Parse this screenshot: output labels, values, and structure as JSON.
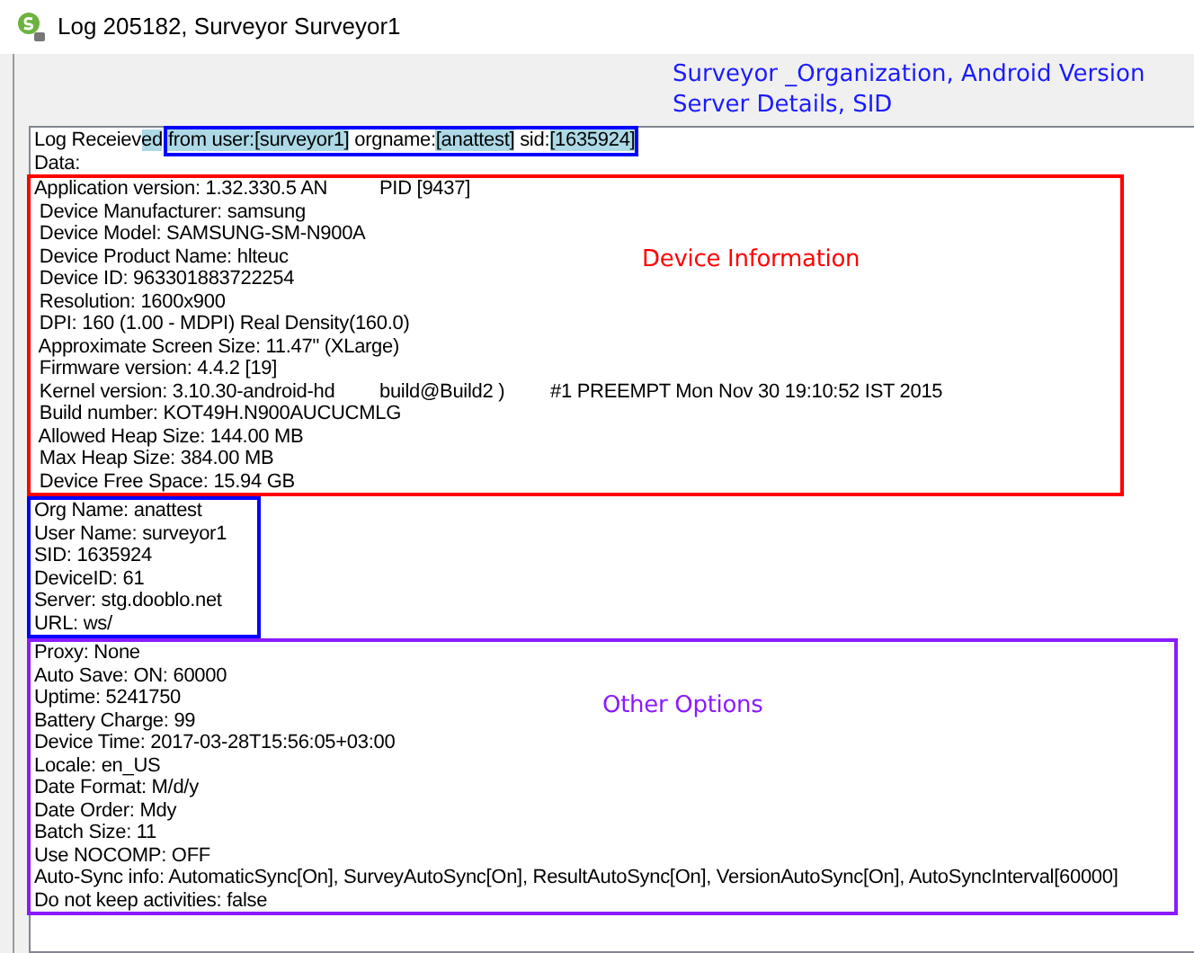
{
  "window": {
    "title": "Log 205182, Surveyor Surveyor1"
  },
  "callout": {
    "lines": [
      "Surveyor _Organization, Android Version",
      "Server Details, SID"
    ],
    "color": "#1a1aff"
  },
  "log": {
    "header": [
      {
        "segments": [
          {
            "text": "Log Receiev",
            "selected": false,
            "outlined": false
          },
          {
            "text": "ed",
            "selected": true,
            "outlined": false
          },
          {
            "text": "from user:[surveyor1]",
            "selected": true,
            "outlined": true
          },
          {
            "text": " orgname:",
            "selected": false,
            "outlined": true
          },
          {
            "text": "[anattest]",
            "selected": true,
            "outlined": true
          },
          {
            "text": " sid:",
            "selected": false,
            "outlined": true
          },
          {
            "text": "[1635924]",
            "selected": true,
            "outlined": true
          }
        ]
      },
      {
        "segments": [
          {
            "text": "Data:",
            "selected": false,
            "outlined": false
          }
        ]
      }
    ],
    "groups": [
      {
        "label": "Device Information",
        "color": "#ff0000",
        "lines": [
          [
            "Application version: 1.32.330.5 AN",
            "PID [9437]"
          ],
          [
            " Device Manufacturer: samsung"
          ],
          [
            " Device Model: SAMSUNG-SM-N900A"
          ],
          [
            " Device Product Name: hlteuc"
          ],
          [
            " Device ID: 963301883722254"
          ],
          [
            " Resolution: 1600x900"
          ],
          [
            " DPI: 160 (1.00 - MDPI) Real Density(160.0)"
          ],
          [
            " Approximate Screen Size: 11.47\" (XLarge)"
          ],
          [
            " Firmware version: 4.4.2 [19]"
          ],
          [
            " Kernel version: 3.10.30-android-hd",
            "build@Build2 )",
            "#1 PREEMPT Mon Nov 30 19:10:52 IST 2015"
          ],
          [
            " Build number: KOT49H.N900AUCUCMLG"
          ],
          [
            " Allowed Heap Size: 144.00 MB"
          ],
          [
            " Max Heap Size: 384.00 MB"
          ],
          [
            " Device Free Space: 15.94 GB"
          ]
        ]
      },
      {
        "color": "#0000ff",
        "lines": [
          [
            "Org Name: anattest"
          ],
          [
            "User Name: surveyor1"
          ],
          [
            "SID: 1635924"
          ],
          [
            "DeviceID: 61"
          ],
          [
            "Server: stg.dooblo.net"
          ],
          [
            "URL: ws/"
          ]
        ]
      },
      {
        "label": "Other Options",
        "color": "#8a1aff",
        "lines": [
          [
            "Proxy: None"
          ],
          [
            "Auto Save: ON: 60000"
          ],
          [
            "Uptime: 5241750"
          ],
          [
            "Battery Charge: 99"
          ],
          [
            "Device Time: 2017-03-28T15:56:05+03:00"
          ],
          [
            "Locale: en_US"
          ],
          [
            "Date Format: M/d/y"
          ],
          [
            "Date Order: Mdy"
          ],
          [
            "Batch Size: 11"
          ],
          [
            "Use NOCOMP: OFF"
          ],
          [
            "Auto-Sync info: AutomaticSync[On], SurveyAutoSync[On], ResultAutoSync[On], VersionAutoSync[On], AutoSyncInterval[60000]"
          ],
          [
            "Do not keep activities: false"
          ]
        ]
      }
    ]
  }
}
